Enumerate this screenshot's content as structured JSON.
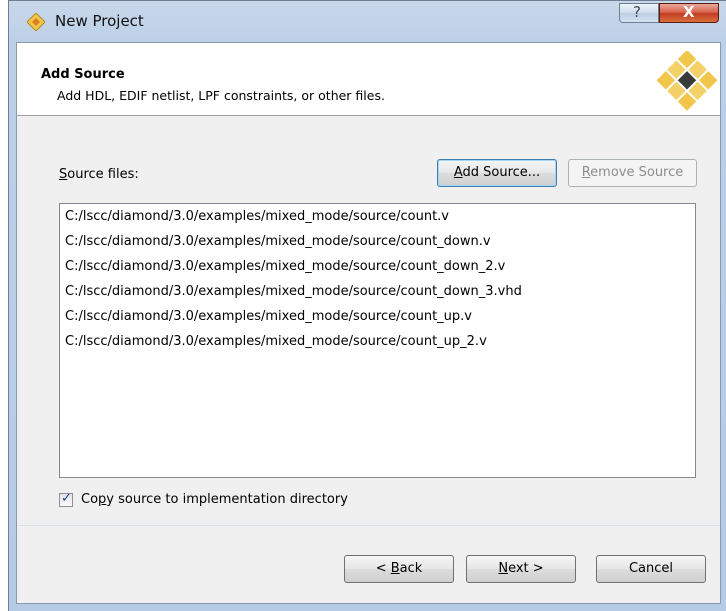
{
  "window": {
    "title": "New Project",
    "help_symbol": "?",
    "close_symbol": "X"
  },
  "header": {
    "title": "Add Source",
    "subtitle": "Add HDL, EDIF netlist, LPF constraints, or other files."
  },
  "source": {
    "label_mnemonic": "S",
    "label_rest": "ource files:",
    "add_button_mnemonic": "A",
    "add_button_rest": "dd Source...",
    "remove_button_mnemonic": "R",
    "remove_button_rest": "emove Source",
    "files": [
      "C:/lscc/diamond/3.0/examples/mixed_mode/source/count.v",
      "C:/lscc/diamond/3.0/examples/mixed_mode/source/count_down.v",
      "C:/lscc/diamond/3.0/examples/mixed_mode/source/count_down_2.v",
      "C:/lscc/diamond/3.0/examples/mixed_mode/source/count_down_3.vhd",
      "C:/lscc/diamond/3.0/examples/mixed_mode/source/count_up.v",
      "C:/lscc/diamond/3.0/examples/mixed_mode/source/count_up_2.v"
    ]
  },
  "copy_option": {
    "checked": true,
    "check_glyph": "✓",
    "label_pre": "Co",
    "label_mnemonic": "p",
    "label_post": "y source to implementation directory"
  },
  "footer": {
    "back_pre": "< ",
    "back_mnemonic": "B",
    "back_post": "ack",
    "next_mnemonic": "N",
    "next_post": "ext >",
    "cancel": "Cancel"
  },
  "colors": {
    "logo_gold": "#f2c64a",
    "logo_dark": "#3a3a3a",
    "close_red": "#c13c24"
  }
}
